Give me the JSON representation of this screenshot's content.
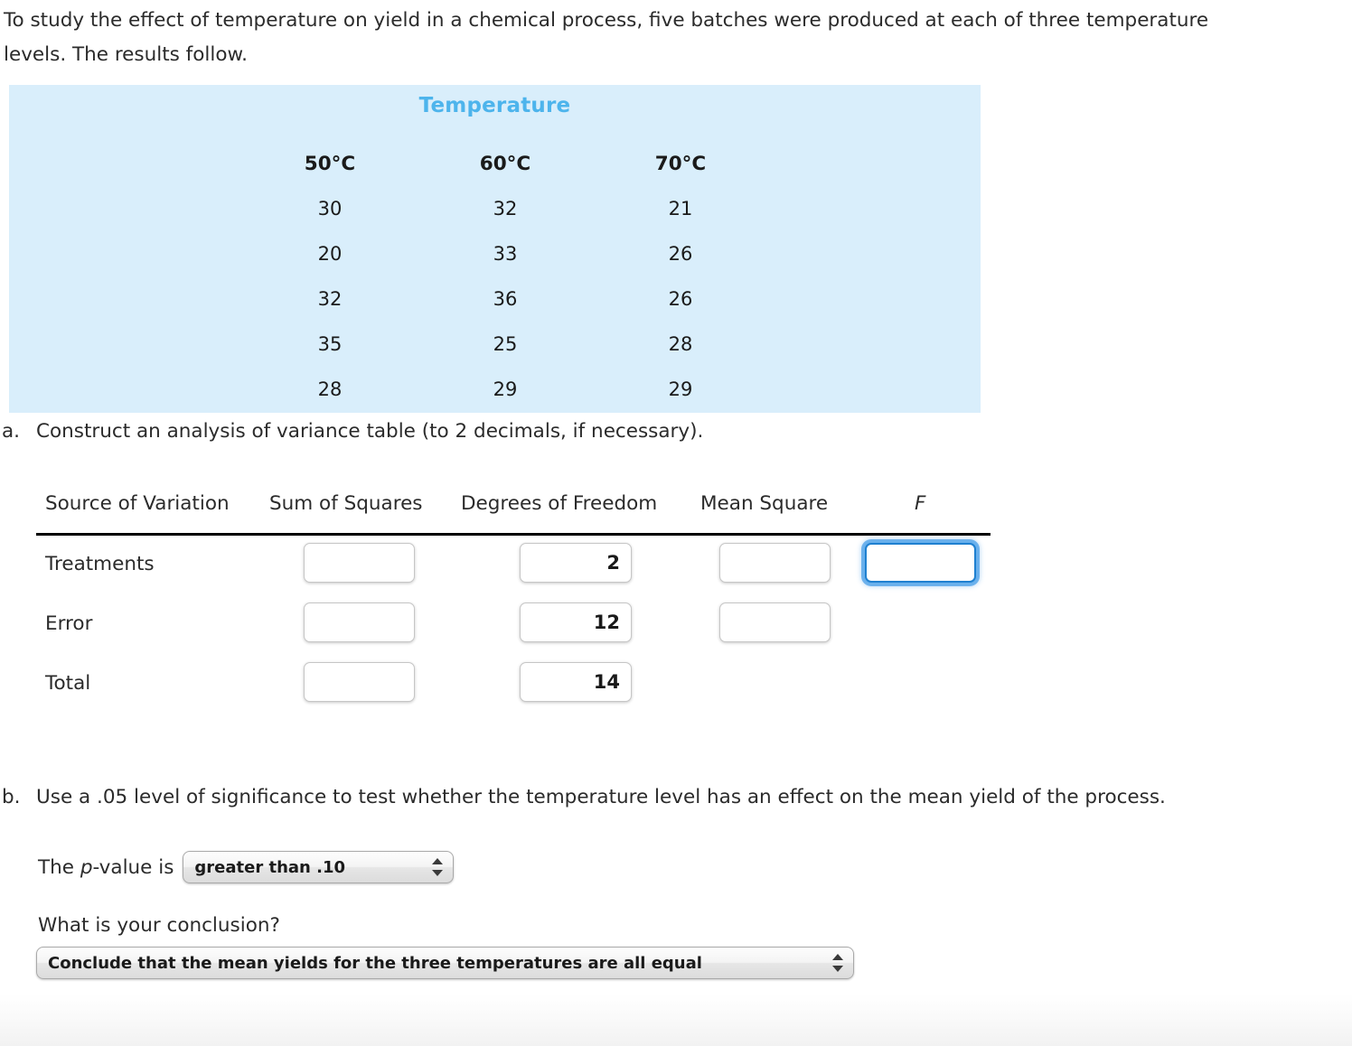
{
  "intro": {
    "text": "To study the effect of temperature on yield in a chemical process, five batches were produced at each of three temperature levels. The results follow."
  },
  "data_panel": {
    "title": "Temperature",
    "columns": [
      "50°C",
      "60°C",
      "70°C"
    ],
    "rows": [
      [
        "30",
        "32",
        "21"
      ],
      [
        "20",
        "33",
        "26"
      ],
      [
        "32",
        "36",
        "26"
      ],
      [
        "35",
        "25",
        "28"
      ],
      [
        "28",
        "29",
        "29"
      ]
    ],
    "background_color": "#d9eefb",
    "title_color": "#4db4ec"
  },
  "question_a": {
    "marker": "a.",
    "text": "Construct an analysis of variance table (to 2 decimals, if necessary)."
  },
  "anova": {
    "headers": {
      "source": "Source of Variation",
      "sum_of_squares": "Sum of Squares",
      "degrees_of_freedom": "Degrees of Freedom",
      "mean_square": "Mean Square",
      "f": "F"
    },
    "rows": [
      {
        "label": "Treatments",
        "sum_of_squares": "",
        "degrees_of_freedom": "2",
        "mean_square": "",
        "f": "",
        "f_focused": true
      },
      {
        "label": "Error",
        "sum_of_squares": "",
        "degrees_of_freedom": "12",
        "mean_square": "",
        "f": null,
        "f_focused": false
      },
      {
        "label": "Total",
        "sum_of_squares": "",
        "degrees_of_freedom": "14",
        "mean_square": null,
        "f": null,
        "f_focused": false
      }
    ],
    "focus_color": "#4ca0e8"
  },
  "question_b": {
    "marker": "b.",
    "text": "Use a .05 level of significance to test whether the temperature level has an effect on the mean yield of the process."
  },
  "p_value": {
    "label_before": "The ",
    "label_italic": "p",
    "label_after": "-value is",
    "selected": "greater than .10"
  },
  "conclusion": {
    "question": "What is your conclusion?",
    "selected": "Conclude that the mean yields for the three temperatures are all equal"
  }
}
